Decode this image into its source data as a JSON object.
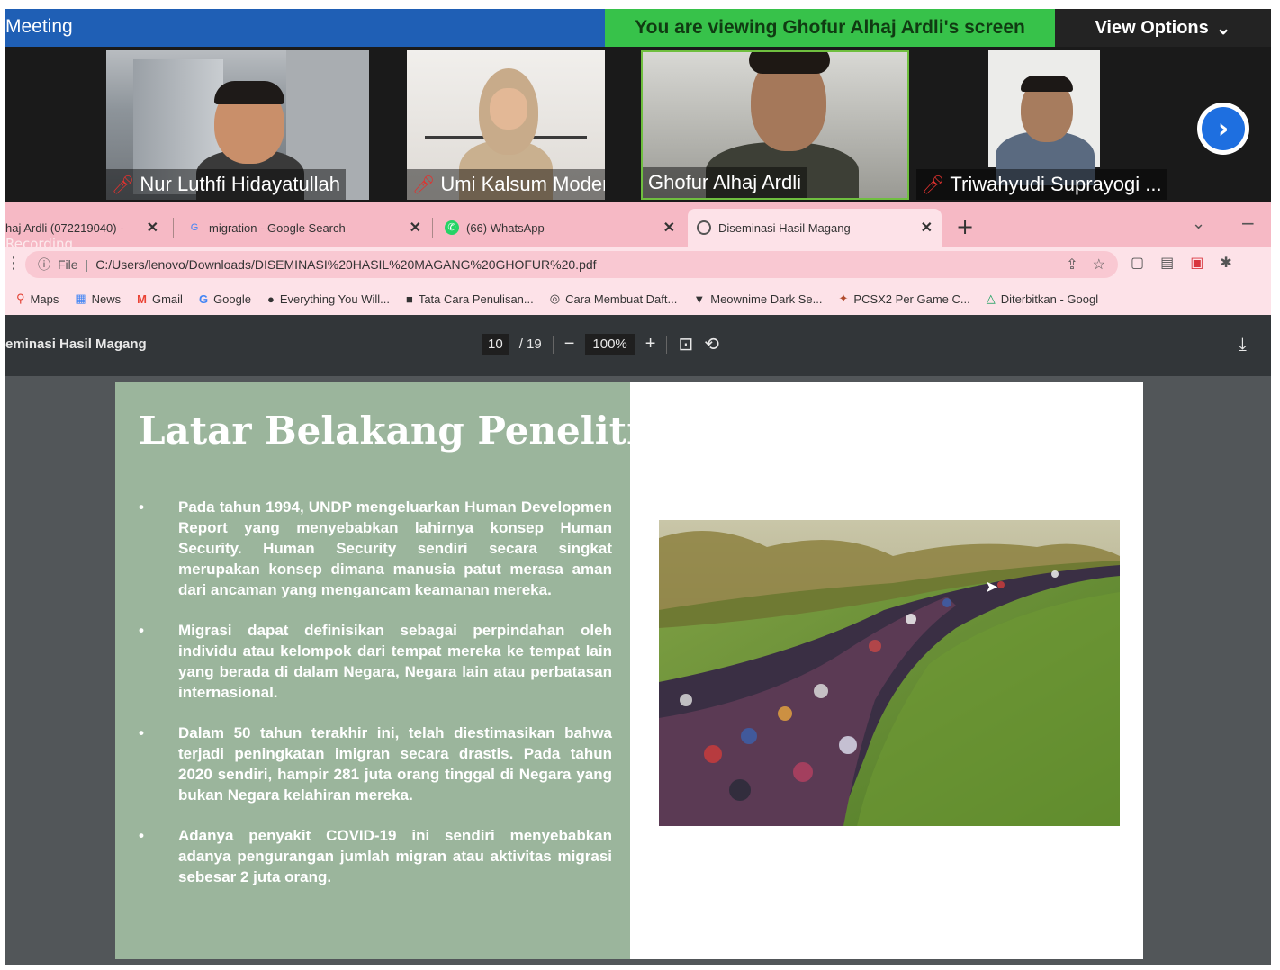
{
  "zoom": {
    "meeting_title": "Meeting",
    "viewing_banner": "You are viewing Ghofur Alhaj Ardli's screen",
    "view_options": "View Options",
    "view_options_icon": "chevron-down-icon",
    "participants": [
      {
        "name": "Nur Luthfi Hidayatullah",
        "muted": true
      },
      {
        "name": "Umi Kalsum Moderator",
        "muted": true
      },
      {
        "name": "Ghofur Alhaj Ardli",
        "muted": false
      },
      {
        "name": "Triwahyudi Suprayogi ...",
        "muted": true
      }
    ],
    "next_icon": "chevron-right-icon"
  },
  "browser": {
    "recording_label": "Recording",
    "tabs": [
      {
        "label": "haj Ardli (072219040) -",
        "active": false
      },
      {
        "label": "migration - Google Search",
        "active": false
      },
      {
        "label": "(66) WhatsApp",
        "active": false
      },
      {
        "label": "Diseminasi Hasil Magang",
        "active": true
      }
    ],
    "address": {
      "scheme": "File",
      "url": "C:/Users/lenovo/Downloads/DISEMINASI%20HASIL%20MAGANG%20GHOFUR%20.pdf"
    },
    "bookmarks": [
      "Maps",
      "News",
      "Gmail",
      "Google",
      "Everything You Will...",
      "Tata Cara Penulisan...",
      "Cara Membuat Daft...",
      "Meownime Dark Se...",
      "PCSX2 Per Game C...",
      "Diterbitkan - Googl"
    ]
  },
  "pdf": {
    "title": "eminasi Hasil Magang",
    "current_page": "10",
    "page_separator": "/ 19",
    "zoom": "100%"
  },
  "slide": {
    "title": "Latar Belakang Penelitian",
    "bullets": [
      "Pada tahun 1994, UNDP mengeluarkan Human Developmen Report yang menyebabkan lahirnya konsep Human Security. Human Security sendiri secara singkat merupakan konsep dimana manusia patut merasa aman dari ancaman yang mengancam keamanan mereka.",
      "Migrasi dapat definisikan sebagai perpindahan oleh individu atau kelompok dari tempat mereka ke tempat lain yang berada di dalam Negara, Negara lain atau perbatasan internasional.",
      "Dalam 50 tahun terakhir ini, telah diestimasikan bahwa terjadi peningkatan imigran secara drastis. Pada tahun 2020 sendiri, hampir 281 juta orang tinggal di Negara yang bukan Negara kelahiran mereka.",
      "Adanya penyakit COVID-19 ini sendiri menyebabkan adanya pengurangan jumlah migran atau aktivitas migrasi sebesar 2 juta orang."
    ]
  },
  "colors": {
    "zoom_blue": "#1f5fb5",
    "banner_green": "#37c24a",
    "tab_pink": "#f6b9c5",
    "slide_green": "#9bb59c"
  }
}
